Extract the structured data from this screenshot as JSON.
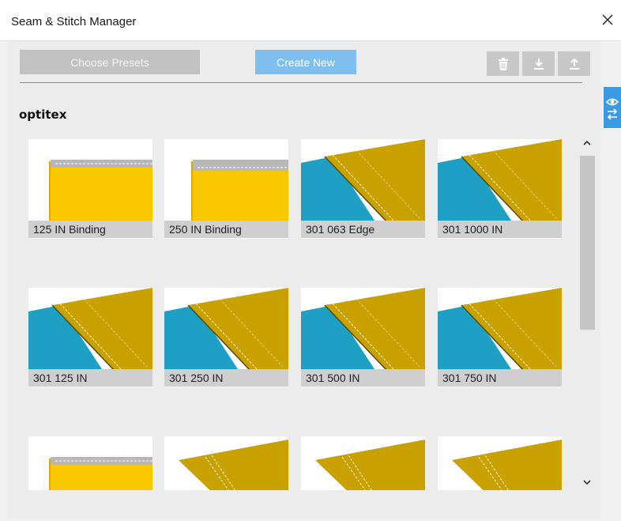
{
  "window": {
    "title": "Seam & Stitch Manager",
    "close_icon": "close-icon"
  },
  "toolbar": {
    "choose_presets_label": "Choose Presets",
    "create_new_label": "Create New",
    "icons": [
      "trash-icon",
      "download-icon",
      "upload-icon"
    ]
  },
  "library": {
    "group_title": "optitex",
    "items": [
      {
        "label": "125 IN Binding",
        "kind": "binding"
      },
      {
        "label": "250 IN Binding",
        "kind": "binding"
      },
      {
        "label": "301 063 Edge",
        "kind": "seam"
      },
      {
        "label": "301 1000 IN",
        "kind": "seam"
      },
      {
        "label": "301 125 IN",
        "kind": "seam"
      },
      {
        "label": "301 250 IN",
        "kind": "seam"
      },
      {
        "label": "301 500 IN",
        "kind": "seam"
      },
      {
        "label": "301 750 IN",
        "kind": "seam"
      },
      {
        "label": "",
        "kind": "binding"
      },
      {
        "label": "",
        "kind": "folded"
      },
      {
        "label": "",
        "kind": "folded"
      },
      {
        "label": "",
        "kind": "folded"
      }
    ]
  },
  "scrollbar": {
    "up_icon": "chevron-up-icon",
    "down_icon": "chevron-down-icon"
  },
  "side_tab": {
    "icon": "eye-swap-icon"
  },
  "colors": {
    "accent_blue": "#7fbff0",
    "side_tab_blue": "#3a9be2",
    "fabric_yellow": "#f8c800",
    "fabric_mustard": "#c9a100",
    "fabric_teal": "#1e9fc4",
    "label_gray": "#cfcfcf"
  }
}
